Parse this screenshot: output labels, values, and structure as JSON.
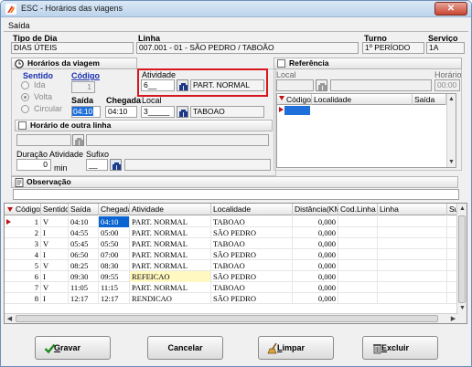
{
  "window": {
    "title": "ESC - Horários das viagens",
    "close_label": "✕"
  },
  "section_title": "Saída",
  "top": {
    "tipo_label": "Tipo de Dia",
    "tipo_value": "DIAS ÚTEIS",
    "linha_label": "Linha",
    "linha_value": "007.001 - 01 - SÃO PEDRO / TABOÃO",
    "turno_label": "Turno",
    "turno_value": "1º PERÍODO",
    "servico_label": "Serviço",
    "servico_value": "1A"
  },
  "horarios": {
    "group_title": "Horários da viagem",
    "sentido_label": "Sentido",
    "sentido_options": [
      "Ida",
      "Volta",
      "Circular"
    ],
    "sentido_selected": "Volta",
    "codigo_label": "Código",
    "codigo_value": "1",
    "atividade_label": "Atividade",
    "atividade_code": "6__",
    "atividade_name": "PART. NORMAL",
    "saida_label": "Saída",
    "saida_value": "04:10",
    "chegada_label": "Chegada",
    "chegada_value": "04:10",
    "local_label": "Local",
    "local_code": "3_____",
    "local_name": "TABOAO"
  },
  "outra_linha": {
    "label": "Horário de outra linha"
  },
  "duracao": {
    "label": "Duração Atividade",
    "value": "0",
    "unit": "min"
  },
  "sufixo": {
    "label": "Sufixo",
    "value": "__"
  },
  "referencia": {
    "label": "Referência",
    "local_label": "Local",
    "horario_label": "Horário",
    "horario_value": "00:00",
    "columns": [
      "Código",
      "Localidade",
      "Saída"
    ]
  },
  "observacao": {
    "label": "Observação",
    "value": ""
  },
  "grid": {
    "columns": [
      "Código",
      "Sentido",
      "Saída",
      "Chegada",
      "Atividade",
      "Localidade",
      "Distância(KM)",
      "Cod.Linha",
      "Linha",
      "Sul"
    ],
    "rows": [
      {
        "codigo": "1",
        "sentido": "V",
        "saida": "04:10",
        "chegada": "04:10",
        "atividade": "PART. NORMAL",
        "localidade": "TABOAO",
        "distancia": "0,000"
      },
      {
        "codigo": "2",
        "sentido": "I",
        "saida": "04:55",
        "chegada": "05:00",
        "atividade": "PART. NORMAL",
        "localidade": "SÃO PEDRO",
        "distancia": "0,000"
      },
      {
        "codigo": "3",
        "sentido": "V",
        "saida": "05:45",
        "chegada": "05:50",
        "atividade": "PART. NORMAL",
        "localidade": "TABOAO",
        "distancia": "0,000"
      },
      {
        "codigo": "4",
        "sentido": "I",
        "saida": "06:50",
        "chegada": "07:00",
        "atividade": "PART. NORMAL",
        "localidade": "SÃO PEDRO",
        "distancia": "0,000"
      },
      {
        "codigo": "5",
        "sentido": "V",
        "saida": "08:25",
        "chegada": "08:30",
        "atividade": "PART. NORMAL",
        "localidade": "TABOAO",
        "distancia": "0,000"
      },
      {
        "codigo": "6",
        "sentido": "I",
        "saida": "09:30",
        "chegada": "09:55",
        "atividade": "REFEICAO",
        "localidade": "SÃO PEDRO",
        "distancia": "0,000"
      },
      {
        "codigo": "7",
        "sentido": "V",
        "saida": "11:05",
        "chegada": "11:15",
        "atividade": "PART. NORMAL",
        "localidade": "TABOAO",
        "distancia": "0,000"
      },
      {
        "codigo": "8",
        "sentido": "I",
        "saida": "12:17",
        "chegada": "12:17",
        "atividade": "RENDICAO",
        "localidade": "SÃO PEDRO",
        "distancia": "0,000"
      }
    ]
  },
  "buttons": {
    "gravar": {
      "accel": "G",
      "rest": "ravar"
    },
    "cancelar": {
      "label": "Cancelar"
    },
    "limpar": {
      "accel": "L",
      "rest": "impar"
    },
    "excluir": {
      "accel": "E",
      "rest": "xcluir"
    }
  },
  "colors": {
    "highlight": "#1e6fd9",
    "selected_cell": "#0a64d2",
    "refeicao_bg": "#fff8c0",
    "red_box": "#d8161d",
    "code_blue": "#1a2fb0"
  }
}
